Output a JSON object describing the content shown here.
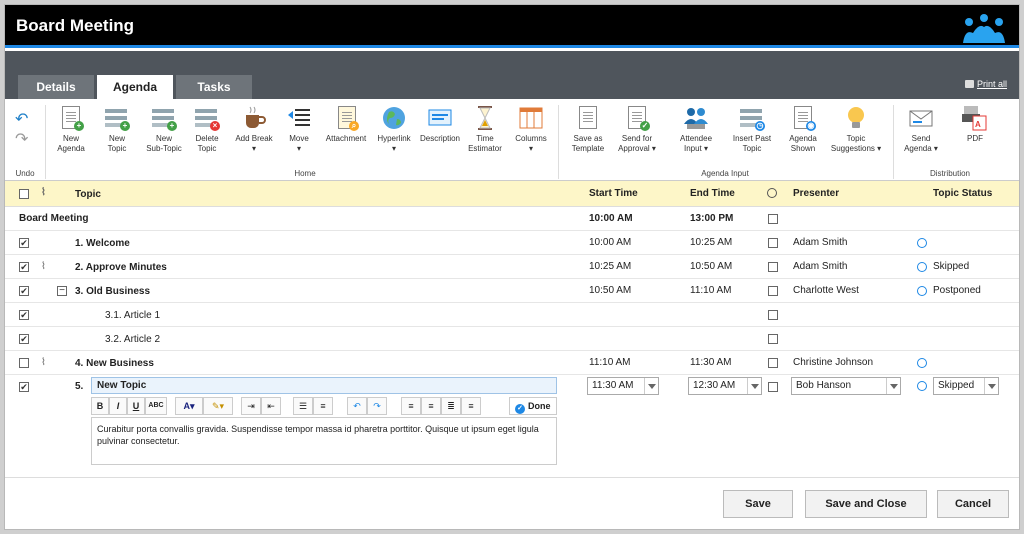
{
  "window": {
    "title": "Board Meeting"
  },
  "tabs": [
    {
      "label": "Details"
    },
    {
      "label": "Agenda"
    },
    {
      "label": "Tasks"
    }
  ],
  "print_all": "Print all",
  "ribbon": {
    "undo_group": "Undo",
    "home_group": "Home",
    "agenda_input_group": "Agenda Input",
    "distribution_group": "Distribution",
    "buttons": {
      "new_agenda": "New\nAgenda",
      "new_topic": "New\nTopic",
      "new_subtopic": "New\nSub-Topic",
      "delete_topic": "Delete\nTopic",
      "add_break": "Add Break\n▾",
      "move": "Move\n▾",
      "attachment": "Attachment",
      "hyperlink": "Hyperlink\n▾",
      "description": "Description",
      "time_estimator": "Time\nEstimator",
      "columns": "Columns\n▾",
      "save_template": "Save as\nTemplate",
      "send_approval": "Send for\nApproval ▾",
      "attendee_input": "Attendee\nInput ▾",
      "insert_past": "Insert Past\nTopic",
      "agenda_shown": "Agenda\nShown",
      "topic_suggestions": "Topic\nSuggestions ▾",
      "send_agenda": "Send\nAgenda ▾",
      "pdf": "PDF"
    }
  },
  "table": {
    "headers": {
      "topic": "Topic",
      "start": "Start Time",
      "end": "End Time",
      "presenter": "Presenter",
      "status": "Topic Status"
    },
    "meeting_row": {
      "topic": "Board Meeting",
      "start": "10:00 AM",
      "end": "13:00 PM"
    },
    "rows": [
      {
        "checked": "✔",
        "topic": "1. Welcome",
        "start": "10:00 AM",
        "end": "10:25 AM",
        "presenter": "Adam Smith",
        "status": ""
      },
      {
        "checked": "✔",
        "topic": "2. Approve Minutes",
        "start": "10:25 AM",
        "end": "10:50 AM",
        "presenter": "Adam Smith",
        "status": "Skipped"
      },
      {
        "checked": "✔",
        "topic": "3. Old Business",
        "start": "10:50 AM",
        "end": "11:10 AM",
        "presenter": "Charlotte West",
        "status": "Postponed"
      },
      {
        "checked": "✔",
        "topic": "3.1. Article 1",
        "start": "",
        "end": "",
        "presenter": "",
        "status": ""
      },
      {
        "checked": "✔",
        "topic": "3.2. Article 2",
        "start": "",
        "end": "",
        "presenter": "",
        "status": ""
      },
      {
        "checked": "",
        "topic": "4. New Business",
        "start": "11:10 AM",
        "end": "11:30 AM",
        "presenter": "Christine Johnson",
        "status": ""
      }
    ],
    "edit_row": {
      "checked": "✔",
      "number": "5.",
      "topic_value": "New Topic",
      "start_value": "11:30 AM",
      "end_value": "12:30 AM",
      "presenter_value": "Bob Hanson",
      "status_value": "Skipped",
      "description": "Curabitur porta convallis gravida. Suspendisse tempor massa id pharetra porttitor. Quisque ut ipsum eget ligula pulvinar consectetur.",
      "done_label": "Done"
    }
  },
  "footer": {
    "save": "Save",
    "save_close": "Save and Close",
    "cancel": "Cancel"
  }
}
